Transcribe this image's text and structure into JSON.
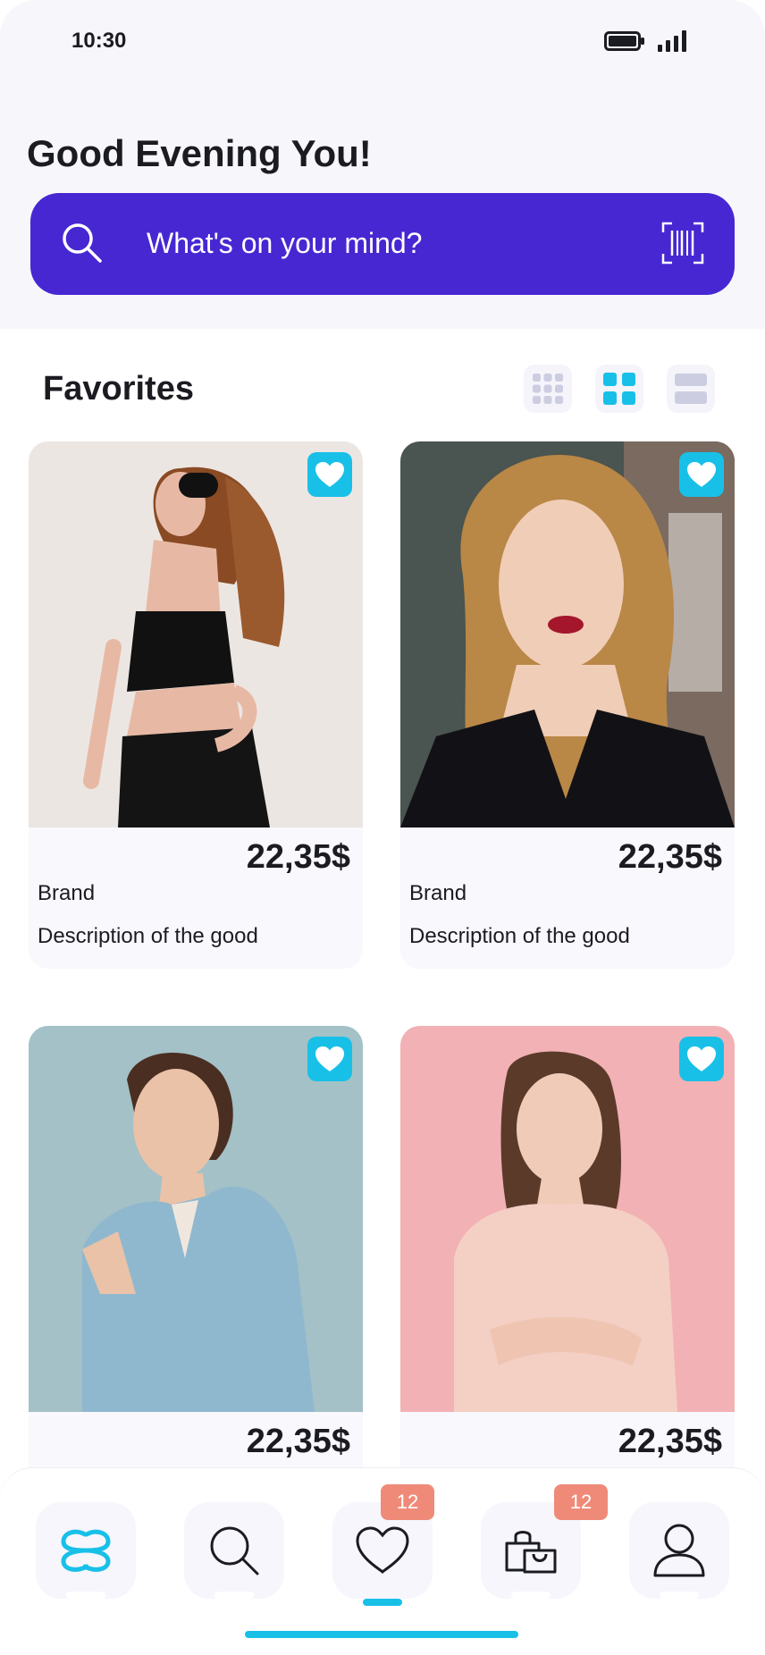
{
  "status_bar": {
    "time": "10:30"
  },
  "header": {
    "greeting": "Good Evening You!",
    "search": {
      "placeholder": "What's on your mind?"
    }
  },
  "favorites": {
    "title": "Favorites",
    "view_modes": [
      "grid-3",
      "grid-2",
      "list"
    ],
    "active_view": "grid-2",
    "items": [
      {
        "price": "22,35$",
        "brand": "Brand",
        "description": "Description of the good",
        "favorited": true
      },
      {
        "price": "22,35$",
        "brand": "Brand",
        "description": "Description of the good",
        "favorited": true
      },
      {
        "price": "22,35$",
        "favorited": true
      },
      {
        "price": "22,35$",
        "favorited": true
      }
    ]
  },
  "bottom_nav": {
    "items": [
      "logo",
      "search",
      "favorites",
      "bag",
      "profile"
    ],
    "active": "favorites",
    "favorites_badge": "12",
    "bag_badge": "12"
  },
  "colors": {
    "accent": "#18c0e8",
    "primary": "#4727d2",
    "badge": "#f08a78"
  }
}
